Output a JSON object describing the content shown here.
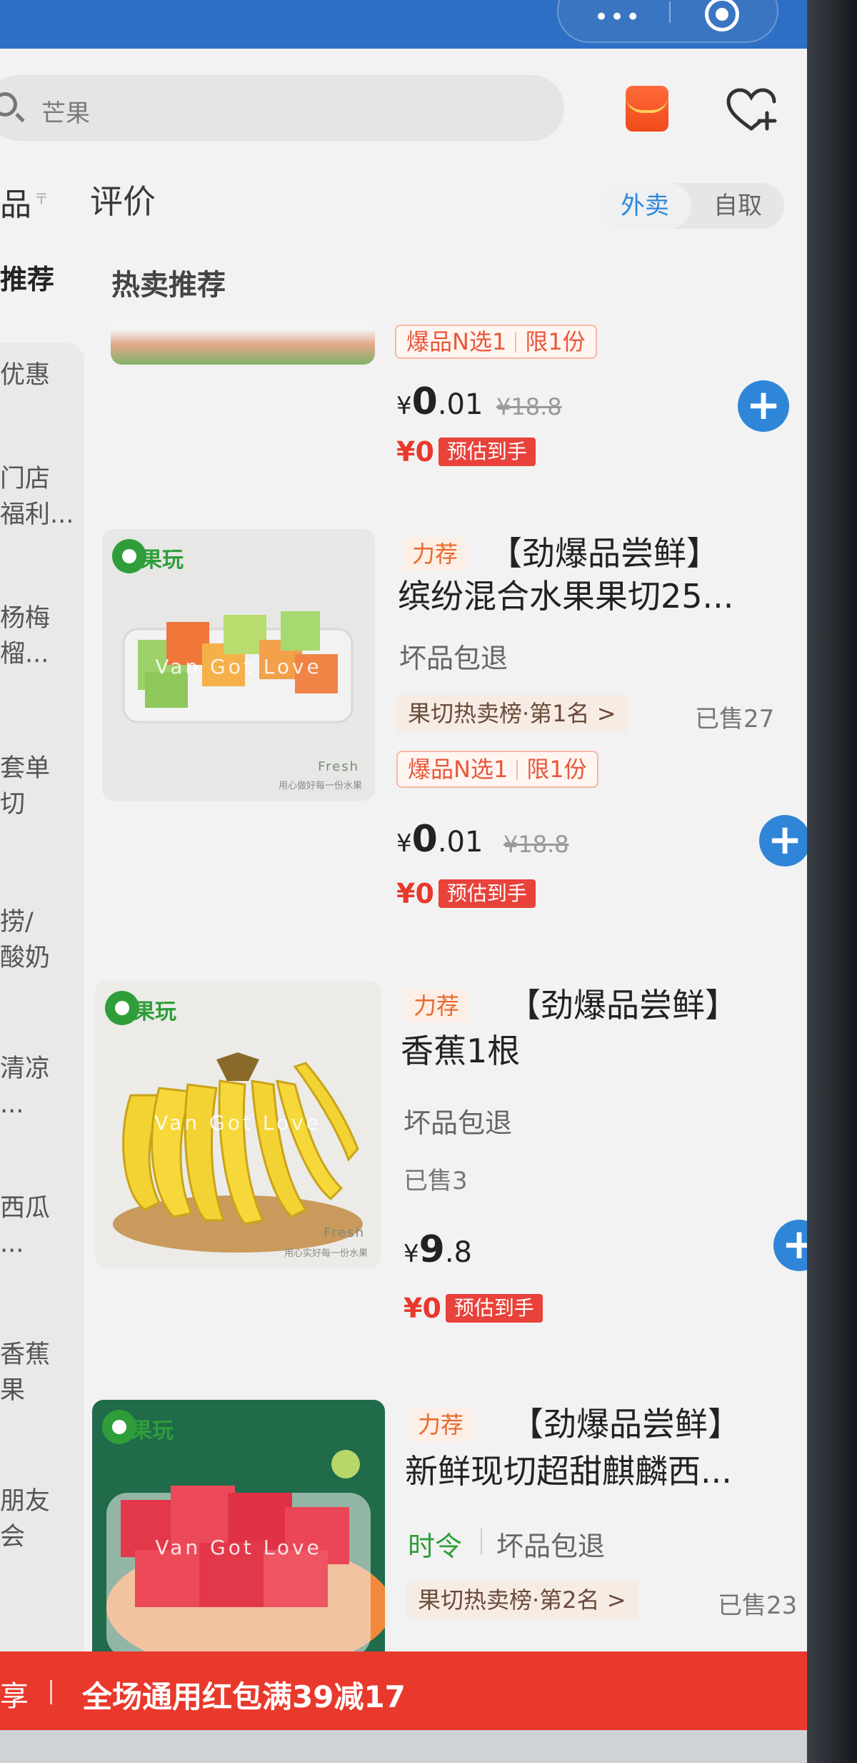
{
  "search": {
    "placeholder_text": "芒果"
  },
  "tabs": {
    "left_partial": "品",
    "left_mark": "〒",
    "review": "评价"
  },
  "mode": {
    "delivery": "外卖",
    "pickup": "自取"
  },
  "sidebar": {
    "active": "推荐",
    "items": [
      "优惠",
      "门店\n福利...",
      "杨梅\n榴...",
      "套单\n切",
      "捞/\n酸奶",
      "清凉\n...",
      "西瓜\n...",
      "香蕉\n果",
      "朋友\n会"
    ]
  },
  "section_title": "热卖推荐",
  "products": [
    {
      "limit_a": "爆品N选1",
      "limit_b": "限1份",
      "price_int": "0",
      "price_dec": ".01",
      "currency": "¥",
      "orig_price": "¥18.8",
      "est_zero": "¥0",
      "est_label": "预估到手"
    },
    {
      "rec_tag": "力荐",
      "title_line1": "【劲爆品尝鲜】",
      "title_line2": "缤纷混合水果果切25...",
      "refund": "坏品包退",
      "rank": "果切热卖榜·第1名 >",
      "sold": "已售27",
      "limit_a": "爆品N选1",
      "limit_b": "限1份",
      "currency": "¥",
      "price_int": "0",
      "price_dec": ".01",
      "orig_price": "¥18.8",
      "est_zero": "¥0",
      "est_label": "预估到手",
      "watermark": "Van Got Love",
      "fresh": "Fresh",
      "slogan": "用心做好每一份水果",
      "logo": "果玩"
    },
    {
      "rec_tag": "力荐",
      "title_line1": "【劲爆品尝鲜】",
      "title_line2": "香蕉1根",
      "refund": "坏品包退",
      "sold": "已售3",
      "currency": "¥",
      "price_int": "9",
      "price_dec": ".8",
      "est_zero": "¥0",
      "est_label": "预估到手",
      "watermark": "Van Got Love",
      "fresh": "Fresh",
      "slogan": "用心实好每一份水果",
      "logo": "果玩"
    },
    {
      "rec_tag": "力荐",
      "title_line1": "【劲爆品尝鲜】",
      "title_line2": "新鲜现切超甜麒麟西...",
      "season": "时令",
      "refund": "坏品包退",
      "rank": "果切热卖榜·第2名 >",
      "sold": "已售23",
      "watermark": "Van Got Love",
      "logo": "果玩"
    }
  ],
  "banner": {
    "left": "享",
    "text": "全场通用红包满39减17"
  },
  "colors": {
    "brand_blue": "#2e6fc6",
    "action_blue": "#2f86d8",
    "promo_red": "#e8392c",
    "season_green": "#2f9e3a"
  }
}
